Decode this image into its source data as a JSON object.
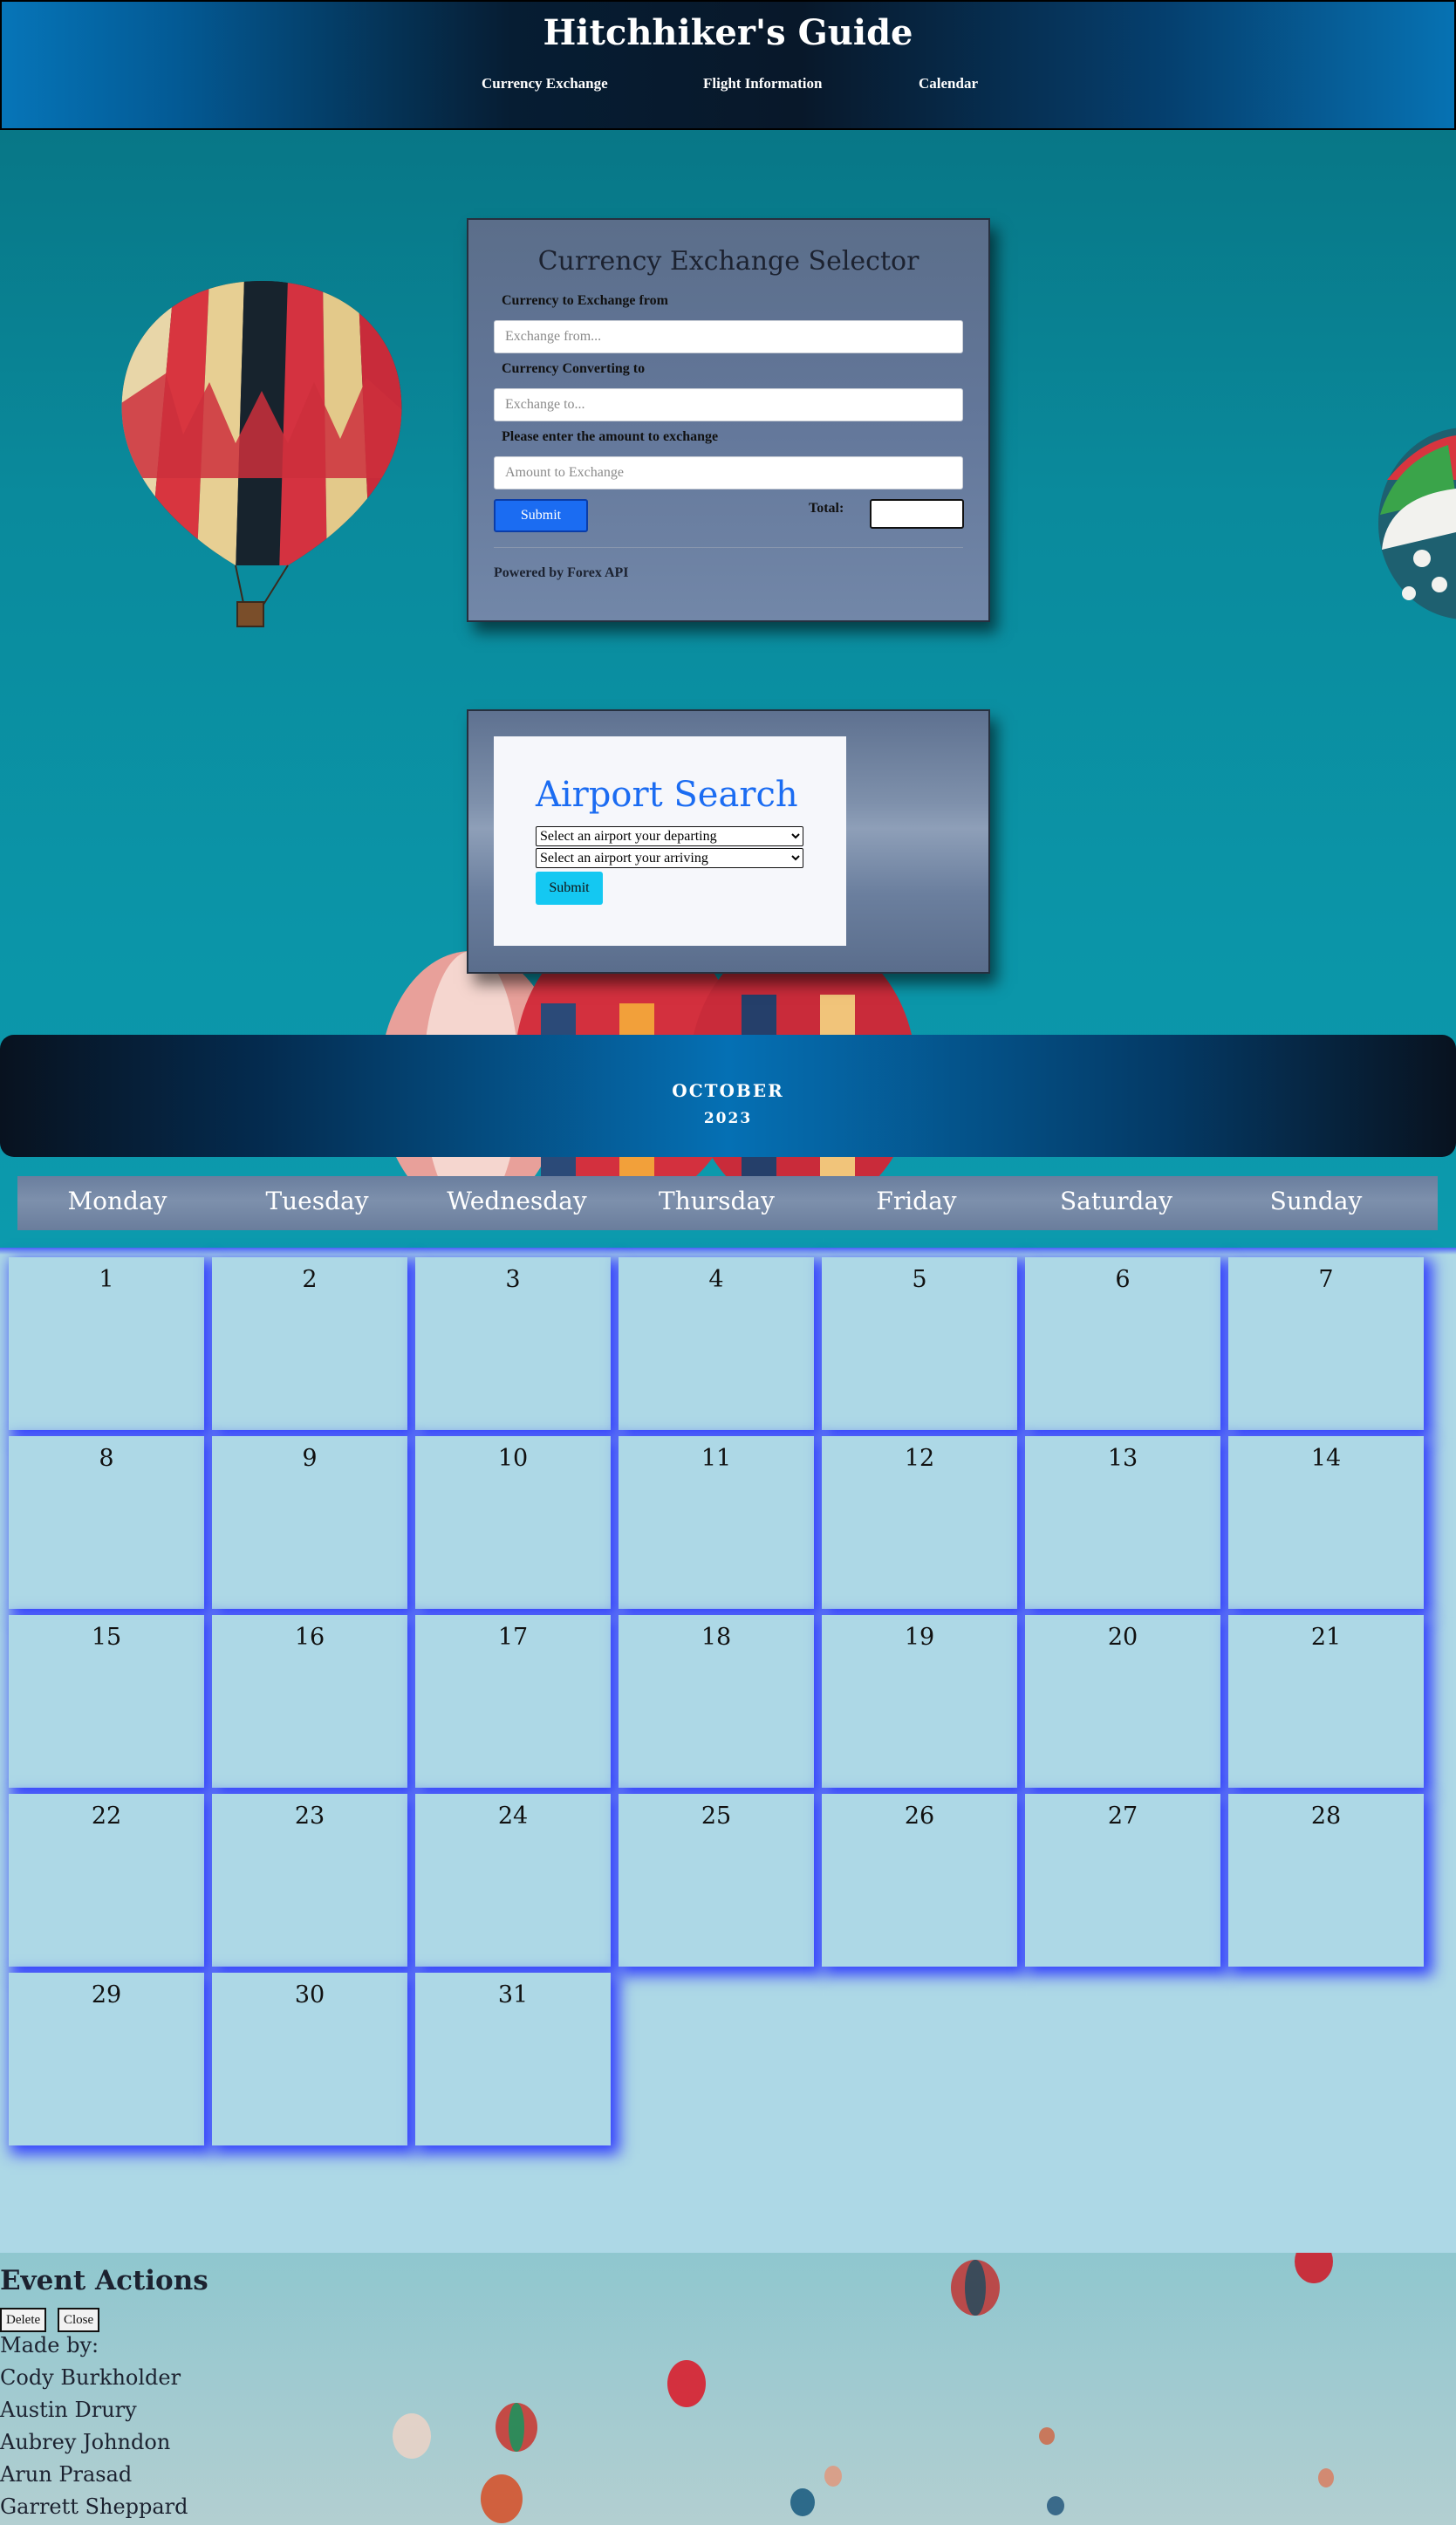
{
  "header": {
    "title": "Hitchhiker's Guide",
    "nav": [
      {
        "label": "Currency Exchange"
      },
      {
        "label": "Flight Information"
      },
      {
        "label": "Calendar"
      }
    ]
  },
  "currency": {
    "title": "Currency Exchange Selector",
    "from_label": "Currency to Exchange from",
    "from_placeholder": "Exchange from...",
    "to_label": "Currency Converting to",
    "to_placeholder": "Exchange to...",
    "amount_label": "Please enter the amount to exchange",
    "amount_placeholder": "Amount to Exchange",
    "submit_label": "Submit",
    "total_label": "Total:",
    "powered_by": "Powered by Forex API"
  },
  "airport": {
    "title": "Airport Search",
    "departing_selected": "Select an airport your departing",
    "arriving_selected": "Select an airport your arriving",
    "submit_label": "Submit"
  },
  "calendar": {
    "month": "OCTOBER",
    "year": "2023",
    "weekdays": [
      "Monday",
      "Tuesday",
      "Wednesday",
      "Thursday",
      "Friday",
      "Saturday",
      "Sunday"
    ],
    "days": [
      "1",
      "2",
      "3",
      "4",
      "5",
      "6",
      "7",
      "8",
      "9",
      "10",
      "11",
      "12",
      "13",
      "14",
      "15",
      "16",
      "17",
      "18",
      "19",
      "20",
      "21",
      "22",
      "23",
      "24",
      "25",
      "26",
      "27",
      "28",
      "29",
      "30",
      "31"
    ]
  },
  "footer": {
    "event_actions_title": "Event Actions",
    "delete_label": "Delete",
    "close_label": "Close",
    "made_by_label": "Made by:",
    "credits": [
      "Cody Burkholder",
      "Austin Drury",
      "Aubrey Johndon",
      "Arun Prasad",
      "Garrett Sheppard"
    ]
  },
  "colors": {
    "accent_blue": "#1b6cf2",
    "accent_cyan": "#14c8f2",
    "calendar_cell": "#add8e6",
    "cell_glow": "#2832ff"
  }
}
